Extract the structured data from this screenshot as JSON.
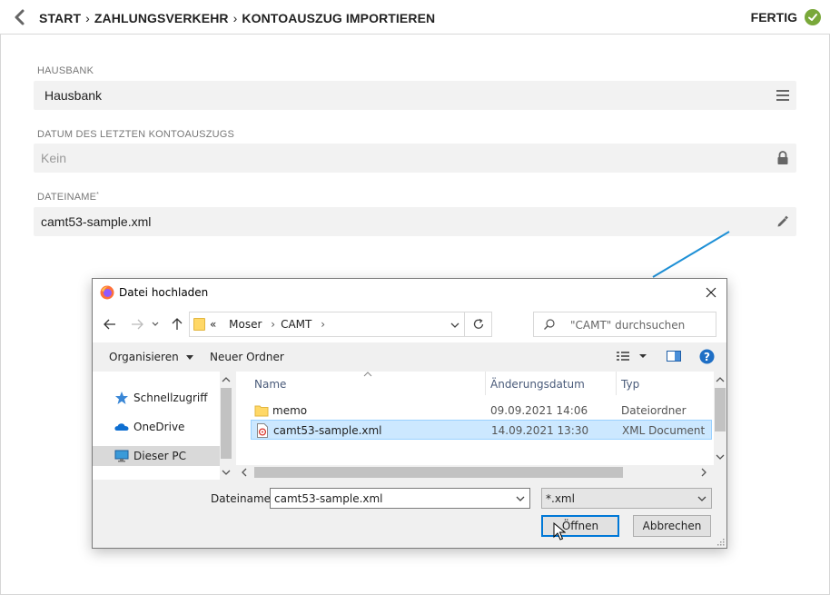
{
  "header": {
    "breadcrumb": [
      "START",
      "ZAHLUNGSVERKEHR",
      "KONTOAUSZUG IMPORTIEREN"
    ],
    "separator": "›",
    "done_label": "FERTIG"
  },
  "form": {
    "hausbank": {
      "label": "HAUSBANK",
      "value": "Hausbank"
    },
    "datum": {
      "label": "DATUM DES LETZTEN KONTOAUSZUGS",
      "value": "Kein"
    },
    "dateiname": {
      "label": "DATEINAME",
      "required_mark": "*",
      "value": "camt53-sample.xml"
    }
  },
  "dialog": {
    "title": "Datei hochladen",
    "address": {
      "prefix": "«",
      "path": [
        "Moser",
        "CAMT"
      ]
    },
    "search_placeholder": "\"CAMT\" durchsuchen",
    "toolbar": {
      "organize": "Organisieren",
      "new_folder": "Neuer Ordner"
    },
    "nav_items": [
      {
        "label": "Schnellzugriff",
        "icon": "star-icon",
        "selected": false
      },
      {
        "label": "OneDrive",
        "icon": "cloud-icon",
        "selected": false
      },
      {
        "label": "Dieser PC",
        "icon": "computer-icon",
        "selected": true
      }
    ],
    "columns": {
      "name": "Name",
      "date": "Änderungsdatum",
      "type": "Typ"
    },
    "files": [
      {
        "name": "memo",
        "date": "09.09.2021 14:06",
        "type": "Dateiordner",
        "icon": "folder-icon",
        "selected": false
      },
      {
        "name": "camt53-sample.xml",
        "date": "14.09.2021 13:30",
        "type": "XML Document",
        "icon": "xml-file-icon",
        "selected": true
      }
    ],
    "filename_label": "Dateiname:",
    "filename_value": "camt53-sample.xml",
    "filetype_value": "*.xml",
    "open_button": "Öffnen",
    "cancel_button": "Abbrechen"
  },
  "colors": {
    "accent_green": "#79a83a",
    "annotation_blue": "#1e90d6",
    "selection_blue": "#cce8ff",
    "button_focus": "#0078d7"
  }
}
